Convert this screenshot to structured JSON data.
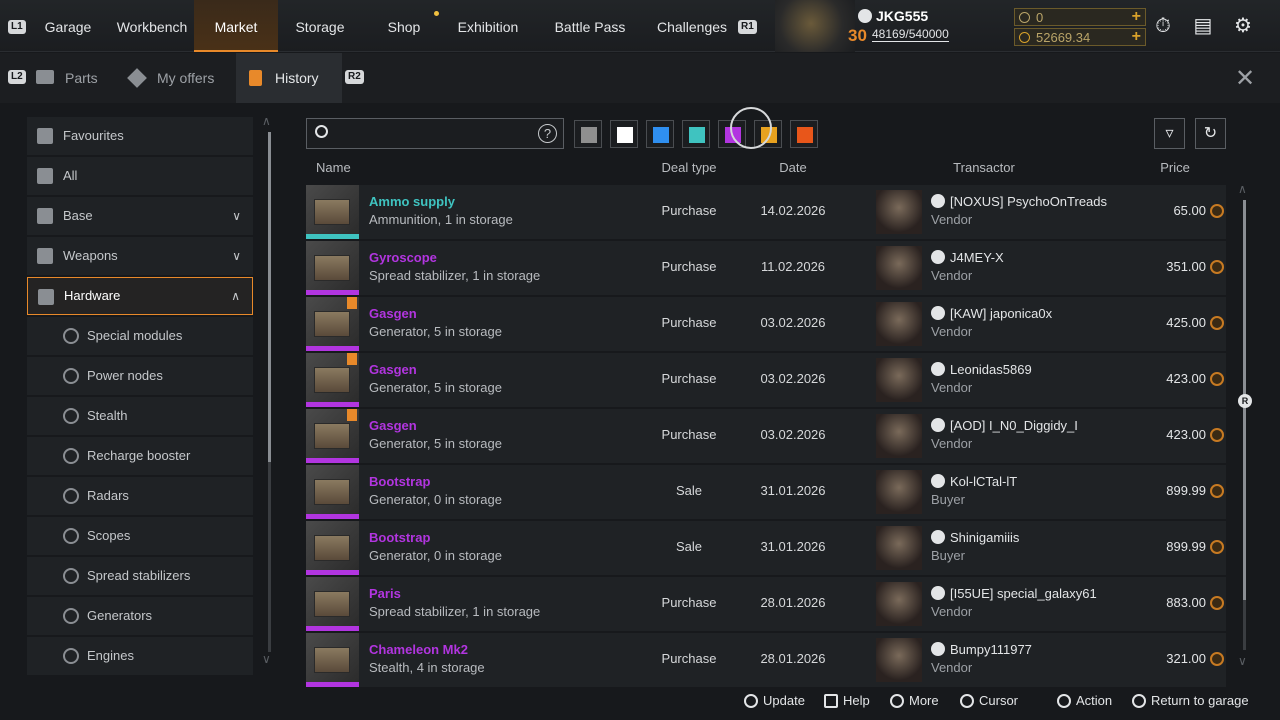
{
  "top_nav": {
    "l1": "L1",
    "r1": "R1",
    "items": [
      {
        "label": "Garage"
      },
      {
        "label": "Workbench"
      },
      {
        "label": "Market"
      },
      {
        "label": "Storage"
      },
      {
        "label": "Shop"
      },
      {
        "label": "Exhibition"
      },
      {
        "label": "Battle Pass"
      },
      {
        "label": "Challenges"
      }
    ],
    "active": "Market"
  },
  "profile": {
    "username": "JKG555",
    "level": "30",
    "xp": "48169/540000"
  },
  "currencies": [
    {
      "value": "0",
      "icon": "coin-icon"
    },
    {
      "value": "52669.34",
      "icon": "coin-icon"
    }
  ],
  "sub_tabs": {
    "l2": "L2",
    "r2": "R2",
    "items": [
      {
        "label": "Parts",
        "icon": "parts-icon"
      },
      {
        "label": "My offers",
        "icon": "tag-icon"
      },
      {
        "label": "History",
        "icon": "history-icon"
      }
    ],
    "active": "History"
  },
  "sidebar": {
    "items": [
      {
        "label": "Favourites",
        "icon": "bookmark-icon"
      },
      {
        "label": "All",
        "icon": "grid-icon"
      },
      {
        "label": "Base",
        "icon": "cabin-icon",
        "expandable": true
      },
      {
        "label": "Weapons",
        "icon": "gun-icon",
        "expandable": true
      },
      {
        "label": "Hardware",
        "icon": "hardware-icon",
        "expanded": true
      },
      {
        "label": "Special modules",
        "icon": "module-icon"
      },
      {
        "label": "Power nodes",
        "icon": "power-icon"
      },
      {
        "label": "Stealth",
        "icon": "stealth-icon"
      },
      {
        "label": "Recharge booster",
        "icon": "booster-icon"
      },
      {
        "label": "Radars",
        "icon": "radar-icon"
      },
      {
        "label": "Scopes",
        "icon": "scope-icon"
      },
      {
        "label": "Spread stabilizers",
        "icon": "stabilizer-icon"
      },
      {
        "label": "Generators",
        "icon": "generator-icon"
      },
      {
        "label": "Engines",
        "icon": "engine-icon"
      }
    ],
    "active": "Hardware"
  },
  "filters": {
    "search_placeholder": "",
    "rarity_colors": [
      "#8f8f8f",
      "#ffffff",
      "#2f8ff0",
      "#3fc3c0",
      "#b235e0",
      "#e8a21f",
      "#e8561a"
    ]
  },
  "table": {
    "columns": [
      "Name",
      "Deal type",
      "Date",
      "Transactor",
      "Price"
    ],
    "rows": [
      {
        "name": "Ammo supply",
        "desc": "Ammunition, 1 in storage",
        "rarity": "#3fc3c0",
        "deal": "Purchase",
        "date": "14.02.2026",
        "transactor": "[NOXUS] PsychoOnTreads",
        "role": "Vendor",
        "price": "65.00"
      },
      {
        "name": "Gyroscope",
        "desc": "Spread stabilizer, 1 in storage",
        "rarity": "#b235e0",
        "deal": "Purchase",
        "date": "11.02.2026",
        "transactor": "J4MEY-X",
        "role": "Vendor",
        "price": "351.00"
      },
      {
        "name": "Gasgen",
        "desc": "Generator, 5 in storage",
        "rarity": "#b235e0",
        "deal": "Purchase",
        "date": "03.02.2026",
        "transactor": "[KAW] japonica0x",
        "role": "Vendor",
        "price": "425.00"
      },
      {
        "name": "Gasgen",
        "desc": "Generator, 5 in storage",
        "rarity": "#b235e0",
        "deal": "Purchase",
        "date": "03.02.2026",
        "transactor": "Leonidas5869",
        "role": "Vendor",
        "price": "423.00"
      },
      {
        "name": "Gasgen",
        "desc": "Generator, 5 in storage",
        "rarity": "#b235e0",
        "deal": "Purchase",
        "date": "03.02.2026",
        "transactor": "[AOD] I_N0_Diggidy_I",
        "role": "Vendor",
        "price": "423.00"
      },
      {
        "name": "Bootstrap",
        "desc": "Generator, 0 in storage",
        "rarity": "#b235e0",
        "deal": "Sale",
        "date": "31.01.2026",
        "transactor": "Kol-lCTal-lT",
        "role": "Buyer",
        "price": "899.99"
      },
      {
        "name": "Bootstrap",
        "desc": "Generator, 0 in storage",
        "rarity": "#b235e0",
        "deal": "Sale",
        "date": "31.01.2026",
        "transactor": "Shinigamiiis",
        "role": "Buyer",
        "price": "899.99"
      },
      {
        "name": "Paris",
        "desc": "Spread stabilizer, 1 in storage",
        "rarity": "#b235e0",
        "deal": "Purchase",
        "date": "28.01.2026",
        "transactor": "[I55UE] special_galaxy61",
        "role": "Vendor",
        "price": "883.00"
      },
      {
        "name": "Chameleon Mk2",
        "desc": "Stealth, 4 in storage",
        "rarity": "#b235e0",
        "deal": "Purchase",
        "date": "28.01.2026",
        "transactor": "Bumpy111977",
        "role": "Vendor",
        "price": "321.00"
      }
    ]
  },
  "footer": [
    {
      "label": "Update",
      "icon": "touchpad-icon"
    },
    {
      "label": "Help",
      "icon": "keyboard-icon"
    },
    {
      "label": "More",
      "icon": "triangle-icon"
    },
    {
      "label": "Cursor",
      "icon": "stick-icon"
    },
    {
      "label": "Action",
      "icon": "cross-icon"
    },
    {
      "label": "Return to garage",
      "icon": "circle-icon"
    }
  ]
}
